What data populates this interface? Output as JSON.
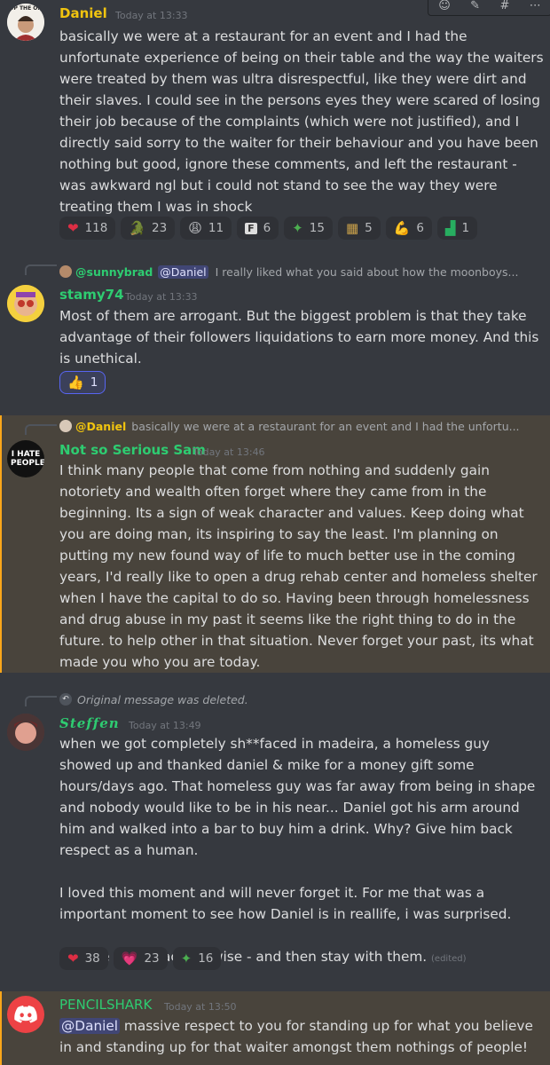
{
  "toolbar": {
    "icons": [
      "emoji-reaction-icon",
      "edit-icon",
      "add-thread-icon",
      "more-icon"
    ]
  },
  "messages": [
    {
      "author": "Daniel",
      "author_color": "#f1c40f",
      "avatar_text": "UP THE ON",
      "time": "Today at 13:33",
      "text": "basically we were at a restaurant for an event and I had the unfortunate experience of being on their table and the way the waiters were treated by them was ultra disrespectful, like they were dirt and their slaves. I could see in the persons eyes they were scared of losing their job because of the complaints (which were not justified), and I directly said sorry to the waiter for their behaviour and you have been nothing but good, ignore these comments, and left the restaurant - was awkward ngl but i could not stand to see the way they were treating them I was in shock",
      "reactions": [
        {
          "emoji": "❤",
          "count": "118"
        },
        {
          "emoji": "🐊",
          "count": "23"
        },
        {
          "emoji": "😩",
          "count": "11"
        },
        {
          "emoji": "F",
          "count": "6"
        },
        {
          "emoji": "✦",
          "count": "15"
        },
        {
          "emoji": "▦",
          "count": "5"
        },
        {
          "emoji": "💪",
          "count": "6"
        },
        {
          "emoji": "▟",
          "count": "1"
        }
      ]
    },
    {
      "reply_to_name": "@sunnybrad",
      "reply_mention": "@Daniel",
      "reply_text": "I really liked what you said about how the moonboys...",
      "author": "stamy74",
      "author_color": "#2ecc71",
      "time": "Today at 13:33",
      "text": "Most of them are arrogant. But the biggest problem is that they take advantage of their followers liquidations to earn more money. And this is unethical.",
      "reactions": [
        {
          "emoji": "👍",
          "count": "1"
        }
      ]
    },
    {
      "reply_to_name": "@Daniel",
      "reply_text": "basically we were at a restaurant for an event and I had the unfortu...",
      "author": "Not so Serious Sam",
      "author_color": "#2ecc71",
      "avatar_text": "I HATE PEOPLE",
      "time": "Today at 13:46",
      "text": "I think many people that come from nothing and suddenly gain notoriety and wealth often forget where they came from in the beginning. Its a sign of weak character and values. Keep doing what you are doing man, its inspiring to say the least. I'm planning on putting my new found way of life to much better use in the coming years, I'd really like to open a drug rehab center and homeless shelter when I have the capital to do so. Having been through homelessness and drug abuse in my past it seems like the right thing to do in the future. to help other in that situation. Never forget your past, its what made you who you are today."
    },
    {
      "reply_text": "Original message was deleted.",
      "author": "Steffen",
      "author_color": "#2ecc71",
      "time": "Today at 13:49",
      "text": "when we got completely sh**faced in madeira, a homeless guy showed up and thanked daniel & mike for a money gift some hours/days ago. That homeless guy was far away from being in shape and nobody would like to be in his near... Daniel got his arm around him and walked into a bar to buy him a drink. Why? Give him back respect as a human.\n\nI loved this moment and will never forget it. For me that was a important moment to see how Daniel is in reallife, i was surprised.\n\nChoose your teachers wise - and then stay with them.",
      "edited": "(edited)",
      "reactions": [
        {
          "emoji": "❤",
          "count": "38"
        },
        {
          "emoji": "💗",
          "count": "23"
        },
        {
          "emoji": "✦",
          "count": "16"
        }
      ]
    },
    {
      "author": "PENCILSHARK",
      "author_color": "#2ecc71",
      "time": "Today at 13:50",
      "mention": "@Daniel",
      "text": " massive respect to you for standing up for what you believe in and standing up for that waiter amongst them nothings of people!"
    }
  ]
}
